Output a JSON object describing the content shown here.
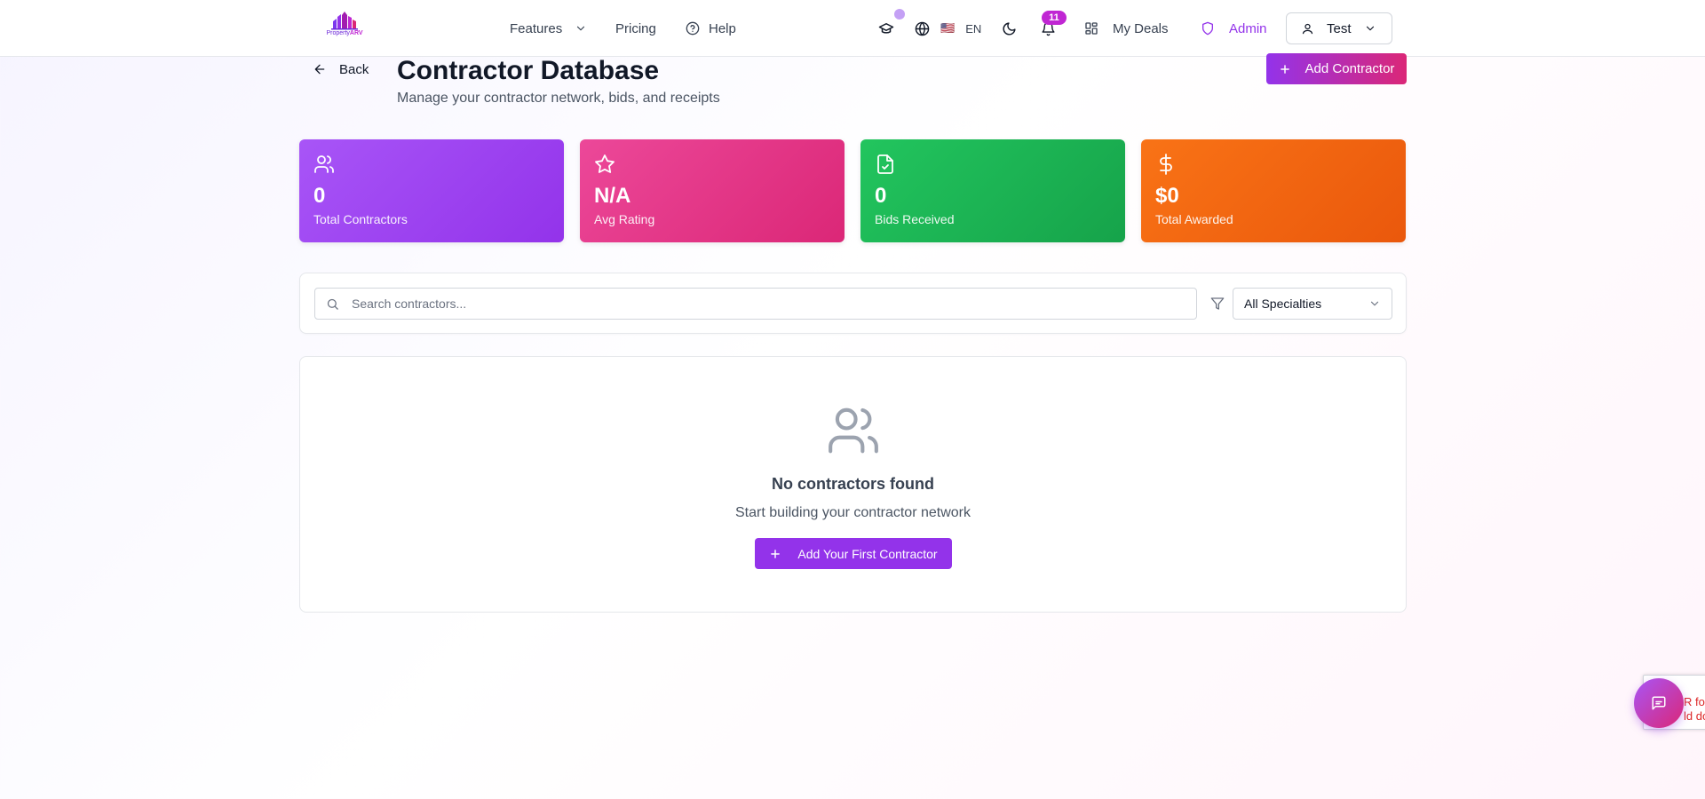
{
  "nav": {
    "logo_text_a": "Property",
    "logo_text_b": "ARV",
    "features": "Features",
    "pricing": "Pricing",
    "help": "Help",
    "language_flag": "🇺🇸",
    "language": "EN",
    "notifications_count": "11",
    "my_deals": "My Deals",
    "admin": "Admin",
    "user": "Test"
  },
  "header": {
    "back": "Back",
    "title": "Contractor Database",
    "subtitle": "Manage your contractor network, bids, and receipts",
    "add_button": "Add Contractor"
  },
  "stats": [
    {
      "value": "0",
      "label": "Total Contractors",
      "icon": "users-icon"
    },
    {
      "value": "N/A",
      "label": "Avg Rating",
      "icon": "star-icon"
    },
    {
      "value": "0",
      "label": "Bids Received",
      "icon": "file-check-icon"
    },
    {
      "value": "$0",
      "label": "Total Awarded",
      "icon": "dollar-icon"
    }
  ],
  "search": {
    "placeholder": "Search contractors...",
    "value": "",
    "specialty_selected": "All Specialties"
  },
  "empty_state": {
    "title": "No contractors found",
    "subtitle": "Start building your contractor network",
    "button": "Add Your First Contractor"
  },
  "recaptcha": {
    "line1": "R fo",
    "line2": "ld do"
  },
  "colors": {
    "accent": "#9333ea",
    "pink": "#db2777",
    "green": "#16a34a",
    "orange": "#ea580c"
  }
}
